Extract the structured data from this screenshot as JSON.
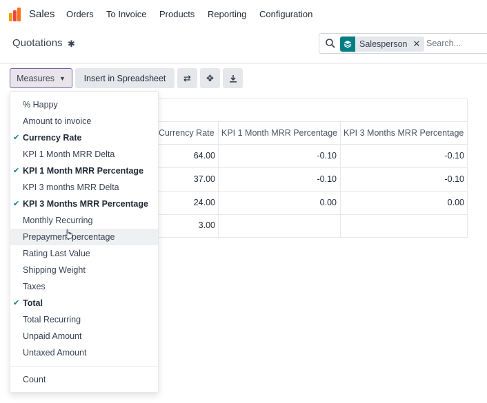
{
  "navbar": {
    "app_name": "Sales",
    "menus": [
      {
        "label": "Orders"
      },
      {
        "label": "To Invoice"
      },
      {
        "label": "Products"
      },
      {
        "label": "Reporting"
      },
      {
        "label": "Configuration"
      }
    ]
  },
  "control": {
    "title": "Quotations",
    "search": {
      "facet_label": "Salesperson",
      "placeholder": "Search..."
    }
  },
  "toolbar": {
    "measures_label": "Measures",
    "spreadsheet_label": "Insert in Spreadsheet"
  },
  "pivot": {
    "headers": [
      "Currency Rate",
      "KPI 1 Month MRR Percentage",
      "KPI 3 Months MRR Percentage"
    ],
    "rows": [
      [
        "64.00",
        "-0.10",
        "-0.10"
      ],
      [
        "37.00",
        "-0.10",
        "-0.10"
      ],
      [
        "24.00",
        "0.00",
        "0.00"
      ],
      [
        "3.00",
        "",
        ""
      ]
    ]
  },
  "measures": {
    "items": [
      {
        "label": "% Happy",
        "checked": false
      },
      {
        "label": "Amount to invoice",
        "checked": false
      },
      {
        "label": "Currency Rate",
        "checked": true
      },
      {
        "label": "KPI 1 Month MRR Delta",
        "checked": false
      },
      {
        "label": "KPI 1 Month MRR Percentage",
        "checked": true
      },
      {
        "label": "KPI 3 months MRR Delta",
        "checked": false
      },
      {
        "label": "KPI 3 Months MRR Percentage",
        "checked": true
      },
      {
        "label": "Monthly Recurring",
        "checked": false
      },
      {
        "label": "Prepayment percentage",
        "checked": false
      },
      {
        "label": "Rating Last Value",
        "checked": false
      },
      {
        "label": "Shipping Weight",
        "checked": false
      },
      {
        "label": "Taxes",
        "checked": false
      },
      {
        "label": "Total",
        "checked": true
      },
      {
        "label": "Total Recurring",
        "checked": false
      },
      {
        "label": "Unpaid Amount",
        "checked": false
      },
      {
        "label": "Untaxed Amount",
        "checked": false
      }
    ],
    "count_label": "Count",
    "hovered_index": 8
  },
  "colors": {
    "accent": "#017e84",
    "brand": "#71639e"
  }
}
